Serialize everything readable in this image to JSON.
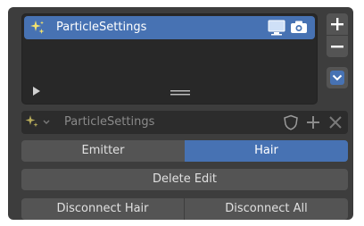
{
  "list": {
    "selected_item": "ParticleSettings"
  },
  "datablock": {
    "name": "ParticleSettings"
  },
  "segment": {
    "emitter_label": "Emitter",
    "hair_label": "Hair",
    "selected": "Hair"
  },
  "buttons": {
    "delete_edit": "Delete Edit",
    "disconnect_hair": "Disconnect Hair",
    "disconnect_all": "Disconnect All"
  },
  "side": {
    "add_icon": "plus-icon",
    "remove_icon": "minus-icon",
    "menu_icon": "chevron-down-icon"
  },
  "colors": {
    "panel": "#3d3d3d",
    "accent": "#4772b3",
    "button": "#545454",
    "list_bg": "#282828",
    "datablock_bg": "#2c2c2c"
  }
}
